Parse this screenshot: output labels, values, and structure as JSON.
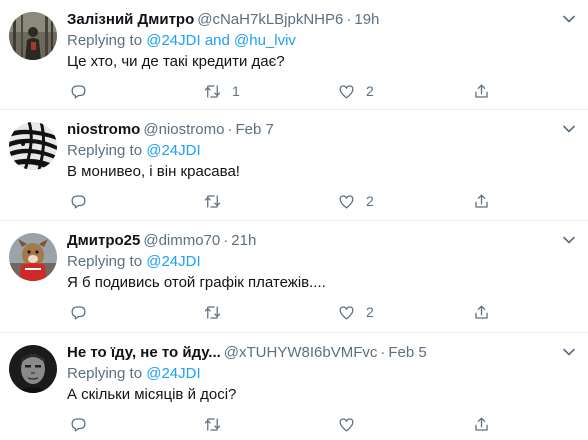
{
  "tweets": [
    {
      "name": "Залізний Дмитро",
      "handle": "@cNaH7kLBjpkNHP6",
      "time": "19h",
      "replying_prefix": "Replying to",
      "mentions": [
        "@24JDI",
        "@hu_lviv"
      ],
      "mention_joiner": "and",
      "text": "Це хто, чи де такі кредити дає?",
      "retweets": "1",
      "likes": "2",
      "avatar": "figure-in-forest"
    },
    {
      "name": "niostromo",
      "handle": "@niostromo",
      "time": "Feb 7",
      "replying_prefix": "Replying to",
      "mentions": [
        "@24JDI"
      ],
      "text": "В монивео, і він красава!",
      "retweets": "",
      "likes": "2",
      "avatar": "zebra"
    },
    {
      "name": "Дмитро25",
      "handle": "@dimmo70",
      "time": "21h",
      "replying_prefix": "Replying to",
      "mentions": [
        "@24JDI"
      ],
      "text": "Я б подивись отой графік платежів....",
      "retweets": "",
      "likes": "2",
      "avatar": "dog-with-red-scarf"
    },
    {
      "name": "Не то їду, не то йду...",
      "handle": "@xTUHYW8I6bVMFvc",
      "time": "Feb 5",
      "replying_prefix": "Replying to",
      "mentions": [
        "@24JDI"
      ],
      "text": "А скільки місяців й досі?",
      "retweets": "",
      "likes": "",
      "avatar": "man-portrait-dark"
    }
  ],
  "colors": {
    "link": "#1da1f2",
    "secondary": "#5b7083",
    "divider": "#e6ecf0"
  }
}
